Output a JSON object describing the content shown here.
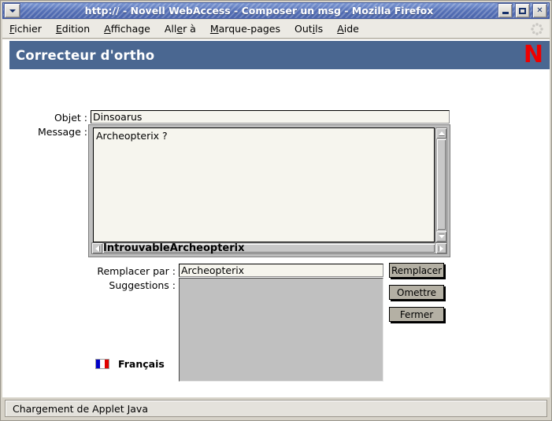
{
  "window": {
    "title": "http://                           - Novell WebAccess - Composer un msg - Mozilla Firefox",
    "system_menu_icon": "chevron-down-icon",
    "minimize_label": "_",
    "maximize_label": "□",
    "close_label": "✕"
  },
  "menubar": {
    "items": [
      {
        "pre": "",
        "accel": "F",
        "post": "ichier"
      },
      {
        "pre": "",
        "accel": "E",
        "post": "dition"
      },
      {
        "pre": "",
        "accel": "A",
        "post": "ffichage"
      },
      {
        "pre": "All",
        "accel": "e",
        "post": "r à"
      },
      {
        "pre": "",
        "accel": "M",
        "post": "arque-pages"
      },
      {
        "pre": "Out",
        "accel": "i",
        "post": "ls"
      },
      {
        "pre": "",
        "accel": "A",
        "post": "ide"
      }
    ],
    "throbber_icon": "throbber-icon"
  },
  "banner": {
    "title": "Correcteur d'ortho",
    "logo_text": "N",
    "logo_icon": "novell-n-logo",
    "bg_color": "#4a6791",
    "logo_color": "#ee0000"
  },
  "form": {
    "objet_label": "Objet :",
    "objet_value": "Dinsoarus",
    "objet_placeholder": "",
    "message_label": "Message :",
    "message_value": "Archeopterix ?",
    "message_placeholder": "",
    "misspelled_word": "IntrouvableArcheopterix",
    "replace_label": "Remplacer par :",
    "replace_value": "Archeopterix",
    "replace_placeholder": "",
    "suggestions_label": "Suggestions :",
    "suggestions": []
  },
  "buttons": {
    "replace": "Remplacer",
    "skip": "Omettre",
    "close": "Fermer"
  },
  "language": {
    "flag_icon": "france-flag-icon",
    "label": "Français"
  },
  "statusbar": {
    "text": "Chargement de Applet Java"
  }
}
